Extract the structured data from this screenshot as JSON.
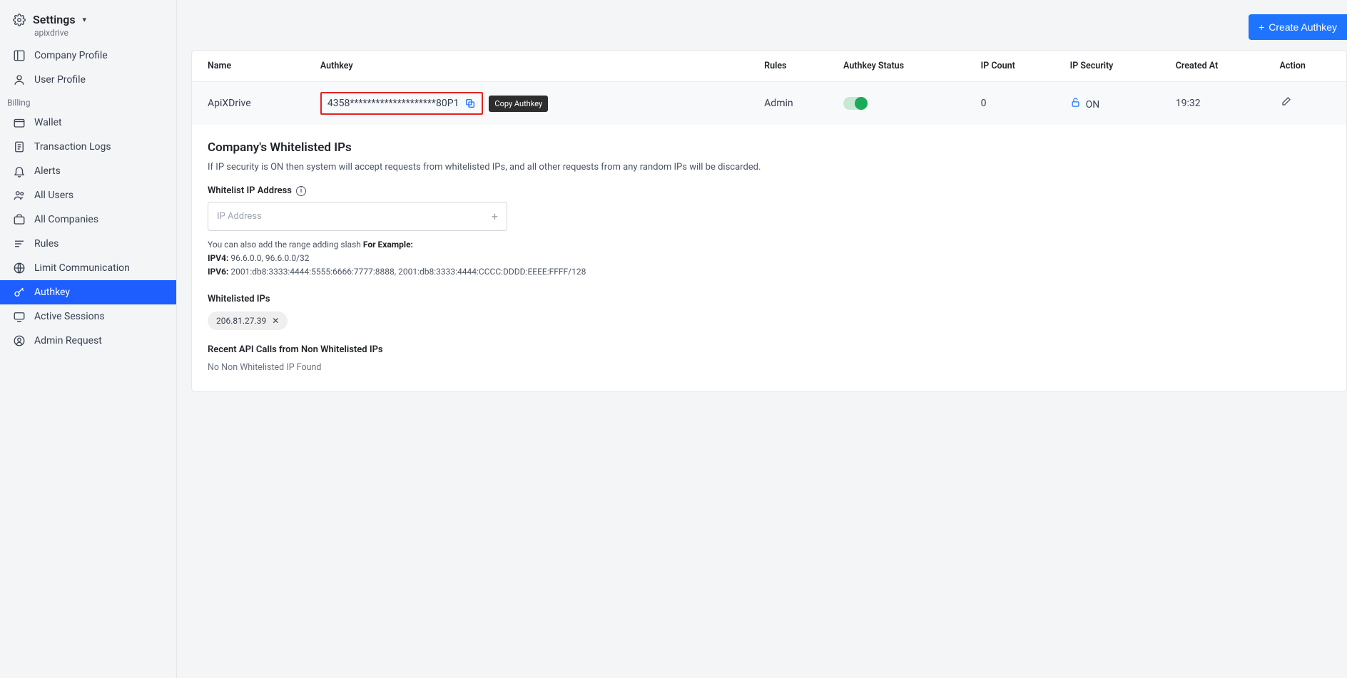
{
  "sidebar": {
    "title": "Settings",
    "subtitle": "apixdrive",
    "top_items": [
      {
        "label": "Company Profile",
        "icon": "layout"
      },
      {
        "label": "User Profile",
        "icon": "user"
      }
    ],
    "section_label": "Billing",
    "billing_items": [
      {
        "label": "Wallet",
        "icon": "wallet"
      },
      {
        "label": "Transaction Logs",
        "icon": "logs"
      },
      {
        "label": "Alerts",
        "icon": "bell"
      },
      {
        "label": "All Users",
        "icon": "users"
      },
      {
        "label": "All Companies",
        "icon": "briefcase"
      },
      {
        "label": "Rules",
        "icon": "lines"
      },
      {
        "label": "Limit Communication",
        "icon": "globe"
      },
      {
        "label": "Authkey",
        "icon": "key",
        "active": true
      },
      {
        "label": "Active Sessions",
        "icon": "sessions"
      },
      {
        "label": "Admin Request",
        "icon": "admin"
      }
    ]
  },
  "topbar": {
    "create_label": "Create Authkey"
  },
  "table": {
    "headers": [
      "Name",
      "Authkey",
      "Rules",
      "Authkey Status",
      "IP Count",
      "IP Security",
      "Created At",
      "Action"
    ],
    "row": {
      "name": "ApiXDrive",
      "authkey": "4358********************80P1",
      "tooltip": "Copy Authkey",
      "rules": "Admin",
      "ip_count": "0",
      "ip_security": "ON",
      "created_at": "19:32"
    }
  },
  "whitelist": {
    "heading": "Company's Whitelisted IPs",
    "desc": "If IP security is ON then system will accept requests from whitelisted IPs, and all other requests from any random IPs will be discarded.",
    "field_label": "Whitelist IP Address",
    "placeholder": "IP Address",
    "hint_intro": "You can also add the range adding slash ",
    "hint_for_example": "For Example:",
    "ipv4_label": "IPV4:",
    "ipv4_vals": " 96.6.0.0, 96.6.0.0/32",
    "ipv6_label": "IPV6:",
    "ipv6_vals": " 2001:db8:3333:4444:5555:6666:7777:8888, 2001:db8:3333:4444:CCCC:DDDD:EEEE:FFFF/128",
    "whitelisted_label": "Whitelisted IPs",
    "chip_ip": "206.81.27.39",
    "recent_label": "Recent API Calls from Non Whitelisted IPs",
    "no_found": "No Non Whitelisted IP Found"
  }
}
